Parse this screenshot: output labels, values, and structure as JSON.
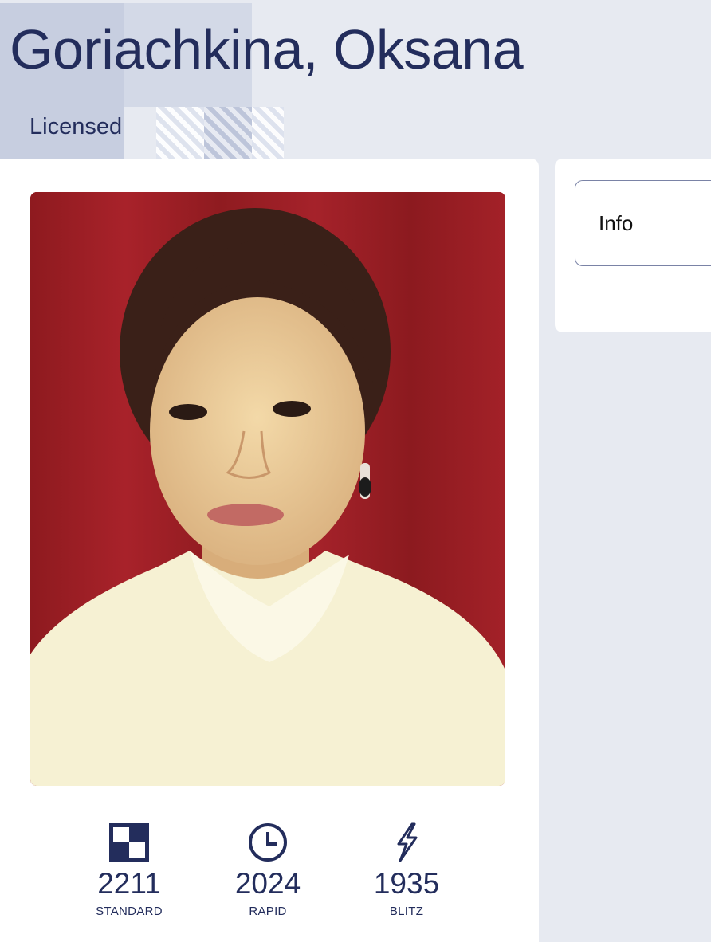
{
  "player": {
    "name": "Goriachkina, Oksana",
    "status": "Licensed"
  },
  "ratings": [
    {
      "value": "2211",
      "label": "STANDARD",
      "icon": "standard-board-icon"
    },
    {
      "value": "2024",
      "label": "RAPID",
      "icon": "clock-icon"
    },
    {
      "value": "1935",
      "label": "BLITZ",
      "icon": "lightning-icon"
    }
  ],
  "tabs": {
    "info_label": "Info"
  },
  "colors": {
    "primary": "#232d5c",
    "background": "#e7eaf1",
    "card": "#ffffff"
  }
}
